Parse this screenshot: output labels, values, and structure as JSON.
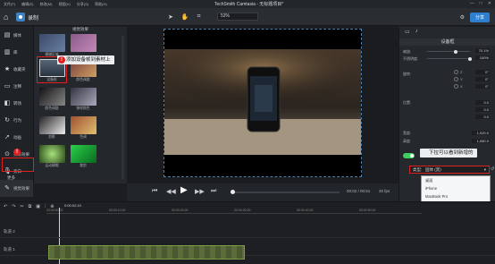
{
  "menubar": {
    "items": [
      "文件(F)",
      "编辑(E)",
      "修改(M)",
      "视图(V)",
      "分享(S)",
      "帮助(H)"
    ],
    "window_title": "TechSmith Camtasia - 无标题项目*",
    "controls": [
      "—",
      "□",
      "✕"
    ]
  },
  "toolbar": {
    "record_label": "录制",
    "zoom_value": "53%",
    "export_label": "分享"
  },
  "leftnav": {
    "items": [
      {
        "icon": "media-icon",
        "label": "媒体"
      },
      {
        "icon": "library-icon",
        "label": "库"
      },
      {
        "icon": "favorites-icon",
        "label": "收藏夹"
      },
      {
        "icon": "annotations-icon",
        "label": "注释"
      },
      {
        "icon": "transitions-icon",
        "label": "转场"
      },
      {
        "icon": "behaviors-icon",
        "label": "行为"
      },
      {
        "icon": "animations-icon",
        "label": "动画"
      },
      {
        "icon": "cursor-effects-icon",
        "label": "光标效果"
      },
      {
        "icon": "voice-narration-icon",
        "label": "旁白"
      },
      {
        "icon": "audio-effects-icon",
        "label": "音频"
      },
      {
        "icon": "visual-effects-icon",
        "label": "视觉效果"
      }
    ],
    "more_label": "更多"
  },
  "assets": {
    "header": "视觉效果",
    "items": [
      {
        "label": "模糊区域"
      },
      {
        "label": ""
      },
      {
        "label": "设备框"
      },
      {
        "label": "颜色调整"
      },
      {
        "label": "颜色调整"
      },
      {
        "label": "移除颜色"
      },
      {
        "label": "剪影"
      },
      {
        "label": "色调"
      },
      {
        "label": "运动模糊"
      },
      {
        "label": "裁剪"
      }
    ]
  },
  "tooltips": {
    "drag_device_frame": "添加设备帧到素材上",
    "dropdown_hint": "下拉可以看到新增的"
  },
  "transport": {
    "time": "00:02 / 00:51",
    "fps": "30 fps",
    "progress": 0.02
  },
  "properties": {
    "title": "设备框",
    "rows": [
      {
        "label": "缩放:",
        "value": "70.1%"
      },
      {
        "label": "不透明度:",
        "value": "100%"
      },
      {
        "label": "旋转:",
        "value": "0.0°"
      },
      {
        "label": "位置:",
        "value": "0.0"
      },
      {
        "label": "",
        "value": "0.0"
      },
      {
        "label": "",
        "value": "0.0"
      },
      {
        "label": "宽度:",
        "value": "1,920.0"
      },
      {
        "label": "高度:",
        "value": "1,080.0"
      }
    ],
    "axes": [
      "Z",
      "Y",
      "X"
    ],
    "axis_values": [
      "0°",
      "0°",
      "0°"
    ],
    "type_label": "类型:",
    "type_value": "固体 (黑)"
  },
  "dropdown": {
    "items": [
      "桌面",
      "iPhone",
      "MacBook Pro",
      "Google Pixel",
      "移动设备 (适用横向手机)",
      "办公桌 (适用横向手机)",
      "固体 (黑)",
      "浏览设备模板...",
      "下载更多设备..."
    ]
  },
  "timeline": {
    "ruler": [
      "00:00:00;00",
      "00:00:10;00",
      "00:00:20;00",
      "00:00:30;00",
      "00:00:40;00",
      "00:00:50;00"
    ],
    "playhead_label": "0:00:02;10",
    "tracks": [
      {
        "label": "轨道 2"
      },
      {
        "label": "轨道 1"
      }
    ]
  },
  "colors": {
    "accent": "#2f7fd0",
    "highlight": "#e02020",
    "toggle": "#3fcf5f"
  }
}
